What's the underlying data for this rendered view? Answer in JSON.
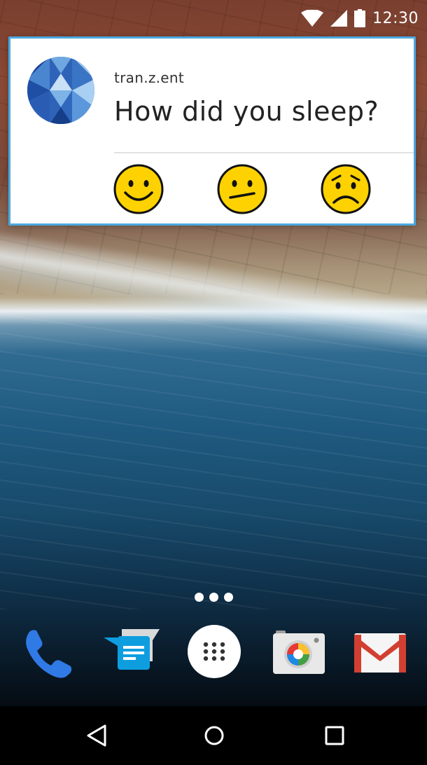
{
  "status_bar": {
    "time": "12:30",
    "icons": [
      "wifi-icon",
      "cell-signal-icon",
      "battery-icon"
    ]
  },
  "notification": {
    "app_name": "tran.z.ent",
    "title": "How did you sleep?",
    "accent_color": "#4aa9e0",
    "actions": [
      {
        "name": "happy-face-icon",
        "meaning": "good"
      },
      {
        "name": "neutral-face-icon",
        "meaning": "okay"
      },
      {
        "name": "sad-face-icon",
        "meaning": "bad"
      }
    ]
  },
  "home": {
    "page_dots": 3
  },
  "dock": {
    "apps": [
      {
        "name": "phone-icon"
      },
      {
        "name": "messenger-icon"
      },
      {
        "name": "app-drawer-icon"
      },
      {
        "name": "camera-icon"
      },
      {
        "name": "gmail-icon"
      }
    ]
  },
  "nav_bar": {
    "buttons": [
      "back-icon",
      "home-icon",
      "recents-icon"
    ]
  }
}
